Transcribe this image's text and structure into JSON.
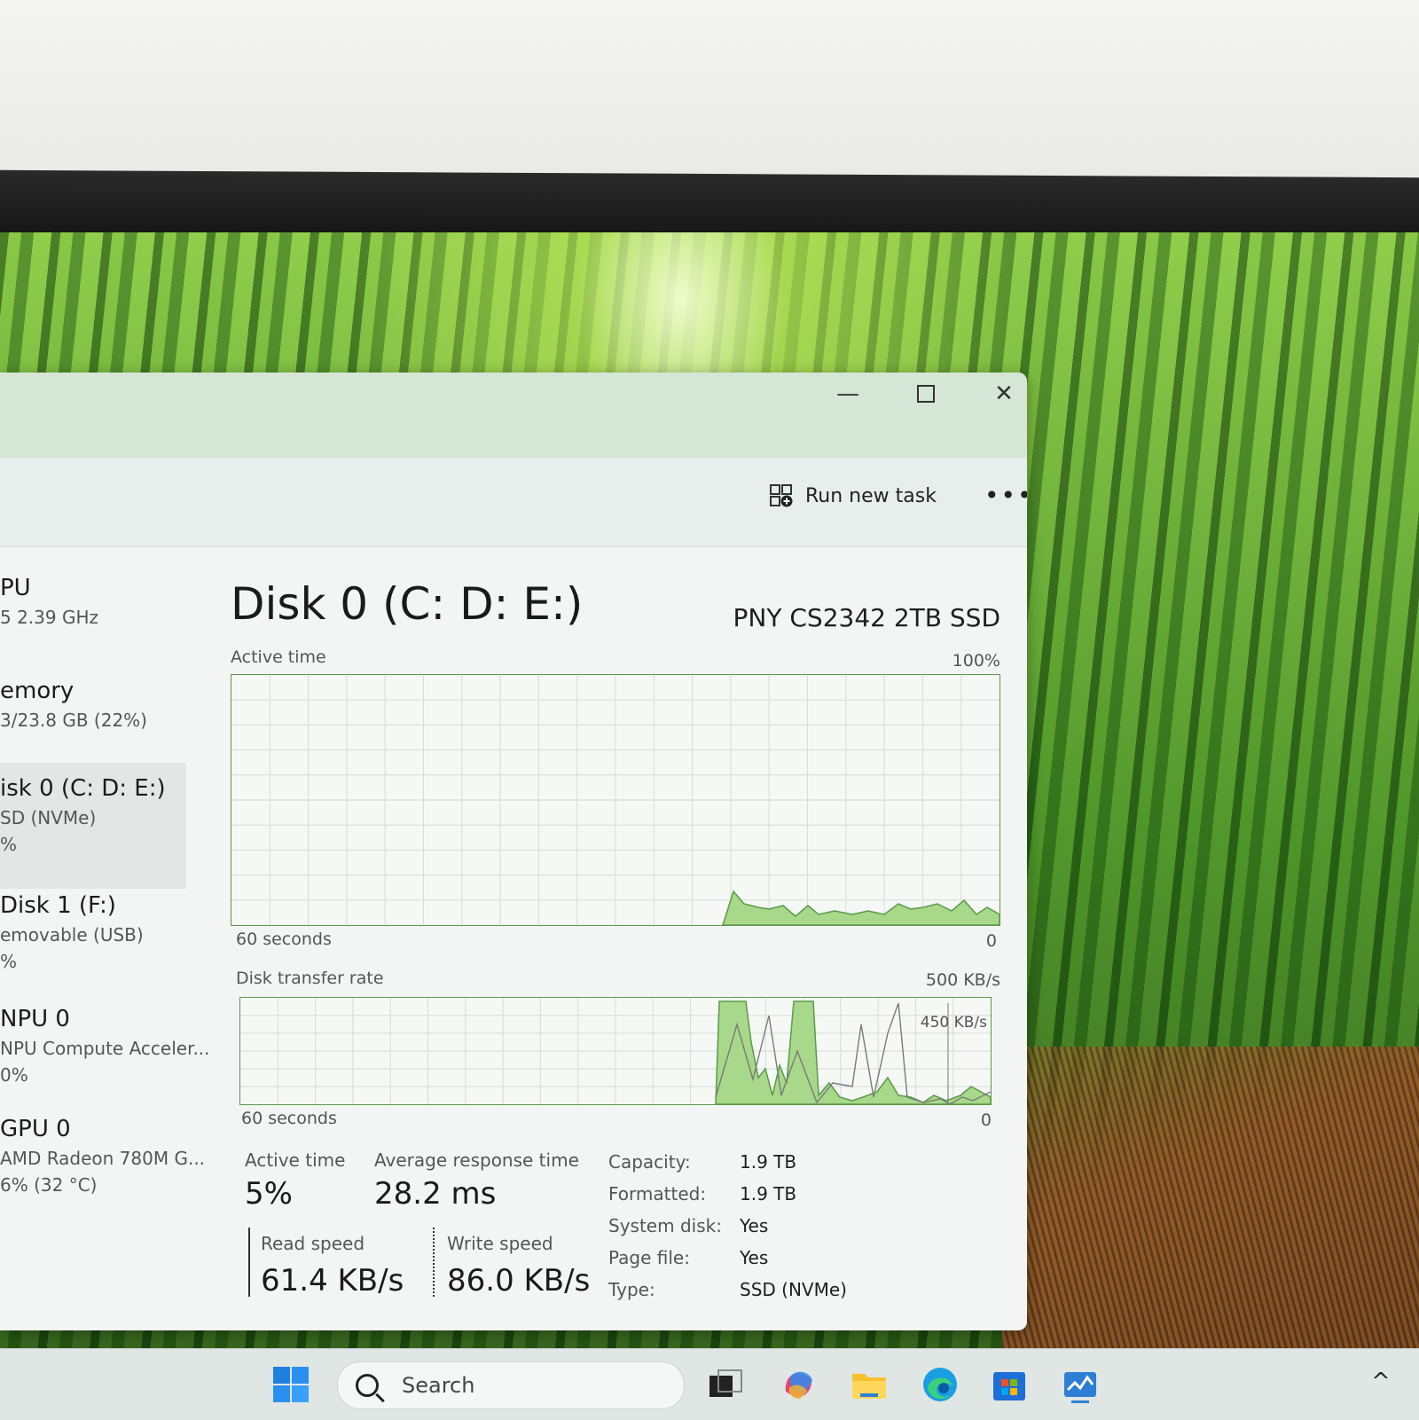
{
  "window": {
    "controls": {
      "minimize": "—",
      "close": "✕"
    },
    "toolbar": {
      "run_new_task": "Run new task",
      "more": "•••"
    }
  },
  "sidebar": {
    "items": [
      {
        "line1": "PU",
        "line2": "5 2.39 GHz"
      },
      {
        "line1": "emory",
        "line2": "3/23.8 GB (22%)"
      },
      {
        "line1": "isk 0 (C: D: E:)",
        "line2": "SD (NVMe)",
        "line3": "%"
      },
      {
        "line1": "Disk 1 (F:)",
        "line2": "emovable (USB)",
        "line3": "%"
      },
      {
        "line1": "NPU 0",
        "line2": "NPU Compute Acceler...",
        "line3": "0%"
      },
      {
        "line1": "GPU 0",
        "line2": "AMD Radeon 780M G...",
        "line3": "6% (32 °C)"
      }
    ]
  },
  "main": {
    "title": "Disk 0 (C: D: E:)",
    "model": "PNY CS2342 2TB SSD",
    "active_graph": {
      "label": "Active time",
      "max": "100%",
      "x_left": "60 seconds",
      "x_right": "0"
    },
    "transfer_graph": {
      "label": "Disk transfer rate",
      "max": "500 KB/s",
      "marker": "450 KB/s",
      "x_left": "60 seconds",
      "x_right": "0"
    },
    "stats": {
      "active_time_label": "Active time",
      "active_time": "5%",
      "avg_resp_label": "Average response time",
      "avg_resp": "28.2 ms",
      "read_label": "Read speed",
      "read": "61.4 KB/s",
      "write_label": "Write speed",
      "write": "86.0 KB/s"
    },
    "props": [
      {
        "k": "Capacity:",
        "v": "1.9 TB"
      },
      {
        "k": "Formatted:",
        "v": "1.9 TB"
      },
      {
        "k": "System disk:",
        "v": "Yes"
      },
      {
        "k": "Page file:",
        "v": "Yes"
      },
      {
        "k": "Type:",
        "v": "SSD (NVMe)"
      }
    ]
  },
  "taskbar": {
    "search_placeholder": "Search",
    "chevron": "^"
  },
  "colors": {
    "graph_line": "#5a9a4a",
    "graph_fill": "#a8d88a",
    "grid": "#d6dbd6"
  }
}
